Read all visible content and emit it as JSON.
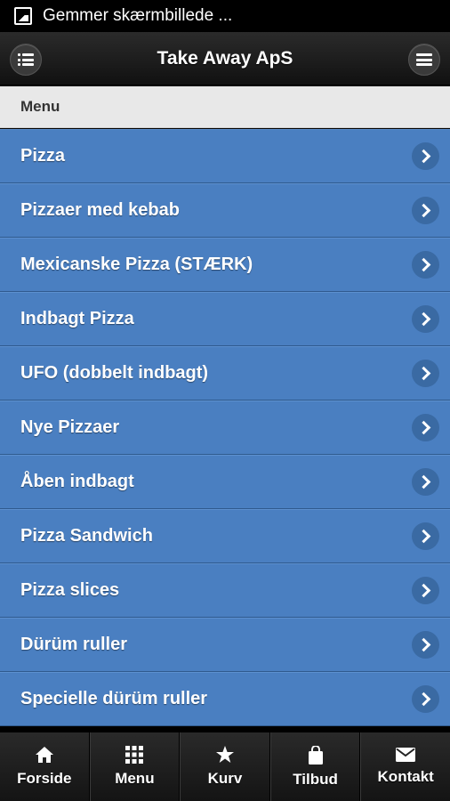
{
  "status_bar": {
    "notification": "Gemmer skærmbillede ..."
  },
  "header": {
    "title": "Take Away ApS",
    "left_icon": "list-icon",
    "right_icon": "menu-icon"
  },
  "section": {
    "title": "Menu"
  },
  "menu_items": [
    {
      "label": "Pizza"
    },
    {
      "label": "Pizzaer med kebab"
    },
    {
      "label": "Mexicanske Pizza (STÆRK)"
    },
    {
      "label": "Indbagt Pizza"
    },
    {
      "label": "UFO (dobbelt indbagt)"
    },
    {
      "label": "Nye Pizzaer"
    },
    {
      "label": "Åben indbagt"
    },
    {
      "label": "Pizza Sandwich"
    },
    {
      "label": "Pizza slices"
    },
    {
      "label": "Dürüm ruller"
    },
    {
      "label": "Specielle dürüm ruller"
    }
  ],
  "tabbar": [
    {
      "label": "Forside",
      "icon": "home-icon"
    },
    {
      "label": "Menu",
      "icon": "grid-icon"
    },
    {
      "label": "Kurv",
      "icon": "star-icon"
    },
    {
      "label": "Tilbud",
      "icon": "bag-icon"
    },
    {
      "label": "Kontakt",
      "icon": "mail-icon"
    }
  ],
  "colors": {
    "item_bg": "#4a7fc1",
    "header_bg": "#1c1c1c",
    "section_bg": "#e8e8e8"
  }
}
